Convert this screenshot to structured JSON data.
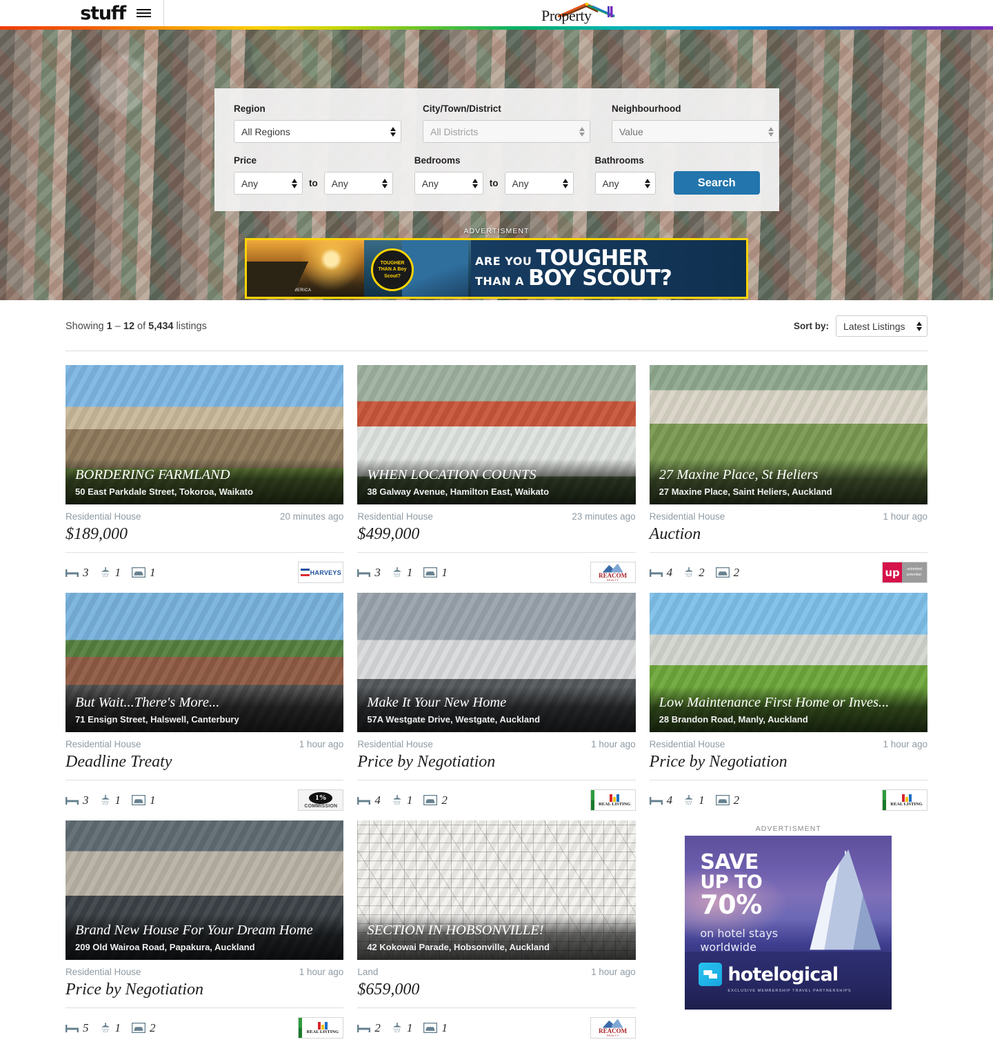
{
  "header": {
    "brand": "stuff",
    "menu_icon": "hamburger-icon",
    "site_logo_text": "Property"
  },
  "search": {
    "region": {
      "label": "Region",
      "value": "All Regions"
    },
    "city": {
      "label": "City/Town/District",
      "placeholder": "All Districts",
      "value": ""
    },
    "neighbourhood": {
      "label": "Neighbourhood",
      "placeholder": "Value",
      "value": ""
    },
    "price": {
      "label": "Price",
      "min": "Any",
      "max": "Any",
      "to": "to"
    },
    "bedrooms": {
      "label": "Bedrooms",
      "min": "Any",
      "max": "Any",
      "to": "to"
    },
    "bathrooms": {
      "label": "Bathrooms",
      "value": "Any"
    },
    "submit": "Search"
  },
  "leaderboard_ad": {
    "caption": "ADVERTISMENT",
    "line1_small": "ARE YOU",
    "line1_big": "TOUGHER",
    "line2_small": "THAN A",
    "line2_big": "BOY SCOUT?",
    "seal_text": "TOUGHER THAN A Boy Scout?",
    "sponsor": "BOY SCOUTS OF AMERICA"
  },
  "results": {
    "showing_prefix": "Showing",
    "range_start": "1",
    "range_dash": "–",
    "range_end": "12",
    "of_word": "of",
    "total": "5,434",
    "listings_word": "listings",
    "sort_label": "Sort by:",
    "sort_value": "Latest Listings",
    "sort_options": [
      "Latest Listings"
    ]
  },
  "listings": [
    {
      "title": "BORDERING FARMLAND",
      "address": "50 East Parkdale Street, Tokoroa, Waikato",
      "category": "Residential House",
      "time": "20 minutes ago",
      "price": "$189,000",
      "beds": "3",
      "baths": "1",
      "cars": "1",
      "agency": "harveys",
      "photo": "ph1"
    },
    {
      "title": "WHEN LOCATION COUNTS",
      "address": "38 Galway Avenue, Hamilton East, Waikato",
      "category": "Residential House",
      "time": "23 minutes ago",
      "price": "$499,000",
      "beds": "3",
      "baths": "1",
      "cars": "1",
      "agency": "reacom",
      "photo": "ph2"
    },
    {
      "title": "27 Maxine Place, St Heliers",
      "address": "27 Maxine Place, Saint Heliers, Auckland",
      "category": "Residential House",
      "time": "1 hour ago",
      "price": "Auction",
      "beds": "4",
      "baths": "2",
      "cars": "2",
      "agency": "up",
      "photo": "ph3"
    },
    {
      "title": "But Wait...There's More...",
      "address": "71 Ensign Street, Halswell, Canterbury",
      "category": "Residential House",
      "time": "1 hour ago",
      "price": "Deadline Treaty",
      "beds": "3",
      "baths": "1",
      "cars": "1",
      "agency": "commission",
      "photo": "ph4"
    },
    {
      "title": "Make It Your New Home",
      "address": "57A Westgate Drive, Westgate, Auckland",
      "category": "Residential House",
      "time": "1 hour ago",
      "price": "Price by Negotiation",
      "beds": "4",
      "baths": "1",
      "cars": "2",
      "agency": "real",
      "photo": "ph5"
    },
    {
      "title": "Low Maintenance First Home or Inves...",
      "address": "28 Brandon Road, Manly, Auckland",
      "category": "Residential House",
      "time": "1 hour ago",
      "price": "Price by Negotiation",
      "beds": "4",
      "baths": "1",
      "cars": "2",
      "agency": "real",
      "photo": "ph6"
    },
    {
      "title": "Brand New House For Your Dream Home",
      "address": "209 Old Wairoa Road, Papakura, Auckland",
      "category": "Residential House",
      "time": "1 hour ago",
      "price": "Price by Negotiation",
      "beds": "5",
      "baths": "1",
      "cars": "2",
      "agency": "real",
      "photo": "ph7"
    },
    {
      "title": "SECTION IN HOBSONVILLE!",
      "address": "42 Kokowai Parade, Hobsonville, Auckland",
      "category": "Land",
      "time": "1 hour ago",
      "price": "$659,000",
      "beds": "2",
      "baths": "1",
      "cars": "1",
      "agency": "reacom",
      "photo": "ph8"
    }
  ],
  "agency_logos": {
    "harveys": "HARVEYS",
    "reacom_name": "REACOM",
    "reacom_sub": "REALTY",
    "up_mark": "up",
    "up_tag_line1": "unlimited",
    "up_tag_line2": "potential.",
    "commission_pct": "1%",
    "commission_word": "COMMISSION",
    "real_listing": "REAL LISTING"
  },
  "mrec_ad": {
    "caption": "ADVERTISMENT",
    "line1": "SAVE",
    "line2": "UP TO",
    "line3": "70%",
    "sub_line1": "on hotel stays",
    "sub_line2": "worldwide",
    "brand": "hotelogical",
    "tagline": "EXCLUSIVE MEMBERSHIP TRAVEL PARTNERSHIPS"
  },
  "colors": {
    "accent_blue": "#2275ad",
    "muted_text": "#8f9ba3",
    "ad_yellow": "#ffd400"
  }
}
